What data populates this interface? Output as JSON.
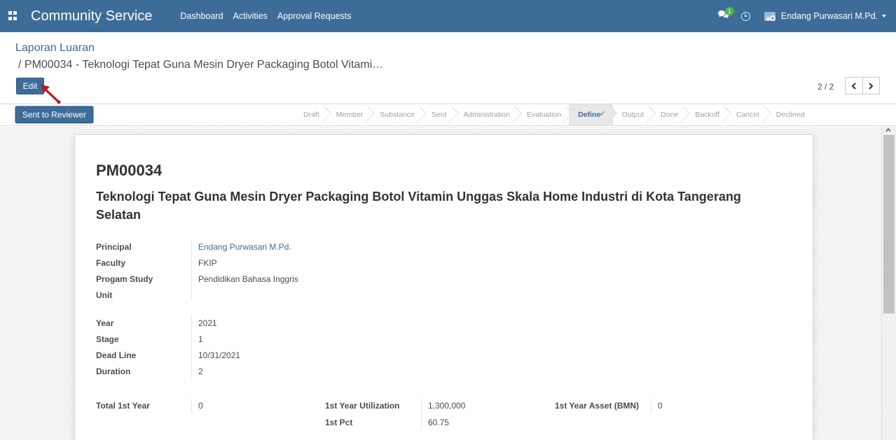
{
  "navbar": {
    "brand": "Community Service",
    "menu": [
      "Dashboard",
      "Activities",
      "Approval Requests"
    ],
    "chat_badge": "1",
    "user": "Endang Purwasari M.Pd."
  },
  "control": {
    "breadcrumb_parent": "Laporan Luaran",
    "breadcrumb_current": "/ PM00034 - Teknologi Tepat Guna Mesin Dryer Packaging Botol Vitami…",
    "edit_label": "Edit",
    "pager": "2 / 2"
  },
  "statusbar": {
    "action_label": "Sent to Reviewer",
    "stages": [
      "Draft",
      "Member",
      "Substance",
      "Sent",
      "Administration",
      "Evaluation",
      "Defined",
      "Output",
      "Done",
      "Backoff",
      "Cancel",
      "Declined"
    ],
    "active_stage": "Defined"
  },
  "record": {
    "code": "PM00034",
    "title": "Teknologi Tepat Guna Mesin Dryer Packaging Botol Vitamin Unggas Skala Home Industri di Kota Tangerang Selatan",
    "fields1": [
      {
        "label": "Principal",
        "value": "Endang Purwasari M.Pd."
      },
      {
        "label": "Faculty",
        "value": "FKIP"
      },
      {
        "label": "Progam Study",
        "value": "Pendidikan Bahasa Inggris"
      },
      {
        "label": "Unit",
        "value": ""
      }
    ],
    "fields2": [
      {
        "label": "Year",
        "value": "2021"
      },
      {
        "label": "Stage",
        "value": "1"
      },
      {
        "label": "Dead Line",
        "value": "10/31/2021"
      },
      {
        "label": "Duration",
        "value": "2"
      }
    ],
    "totals": {
      "total_label": "Total 1st Year",
      "total_value": "0",
      "util_label": "1st Year Utilization",
      "util_value": "1,300,000",
      "pct_label": "1st Pct",
      "pct_value": "60.75",
      "asset_label": "1st Year Asset (BMN)",
      "asset_value": "0"
    }
  },
  "colors": {
    "primary": "#3d6c99",
    "arrow": "#c0161c"
  }
}
